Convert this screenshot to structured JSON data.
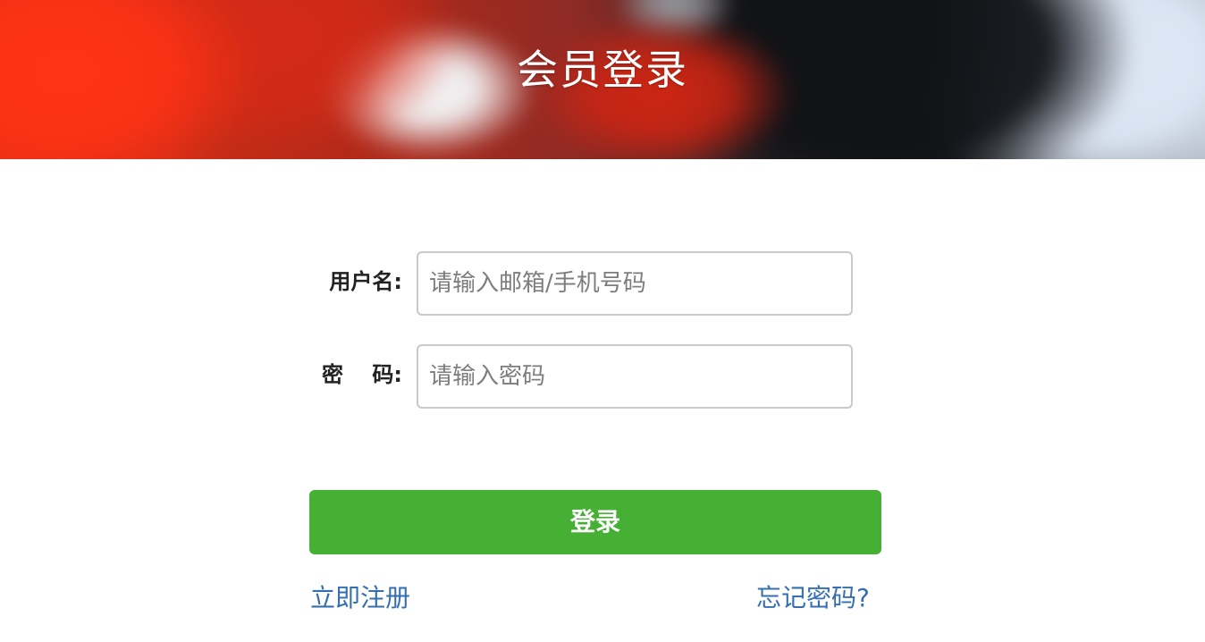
{
  "banner": {
    "title": "会员登录"
  },
  "login_form": {
    "username_label": "用户名:",
    "username_placeholder": "请输入邮箱/手机号码",
    "password_label": "密　 码:",
    "password_placeholder": "请输入密码",
    "submit_label": "登录"
  },
  "links": {
    "register": "立即注册",
    "forgot_password": "忘记密码?"
  },
  "colors": {
    "primary_button": "#46b034",
    "link": "#356fb1",
    "input_border": "#c9c9c9"
  }
}
